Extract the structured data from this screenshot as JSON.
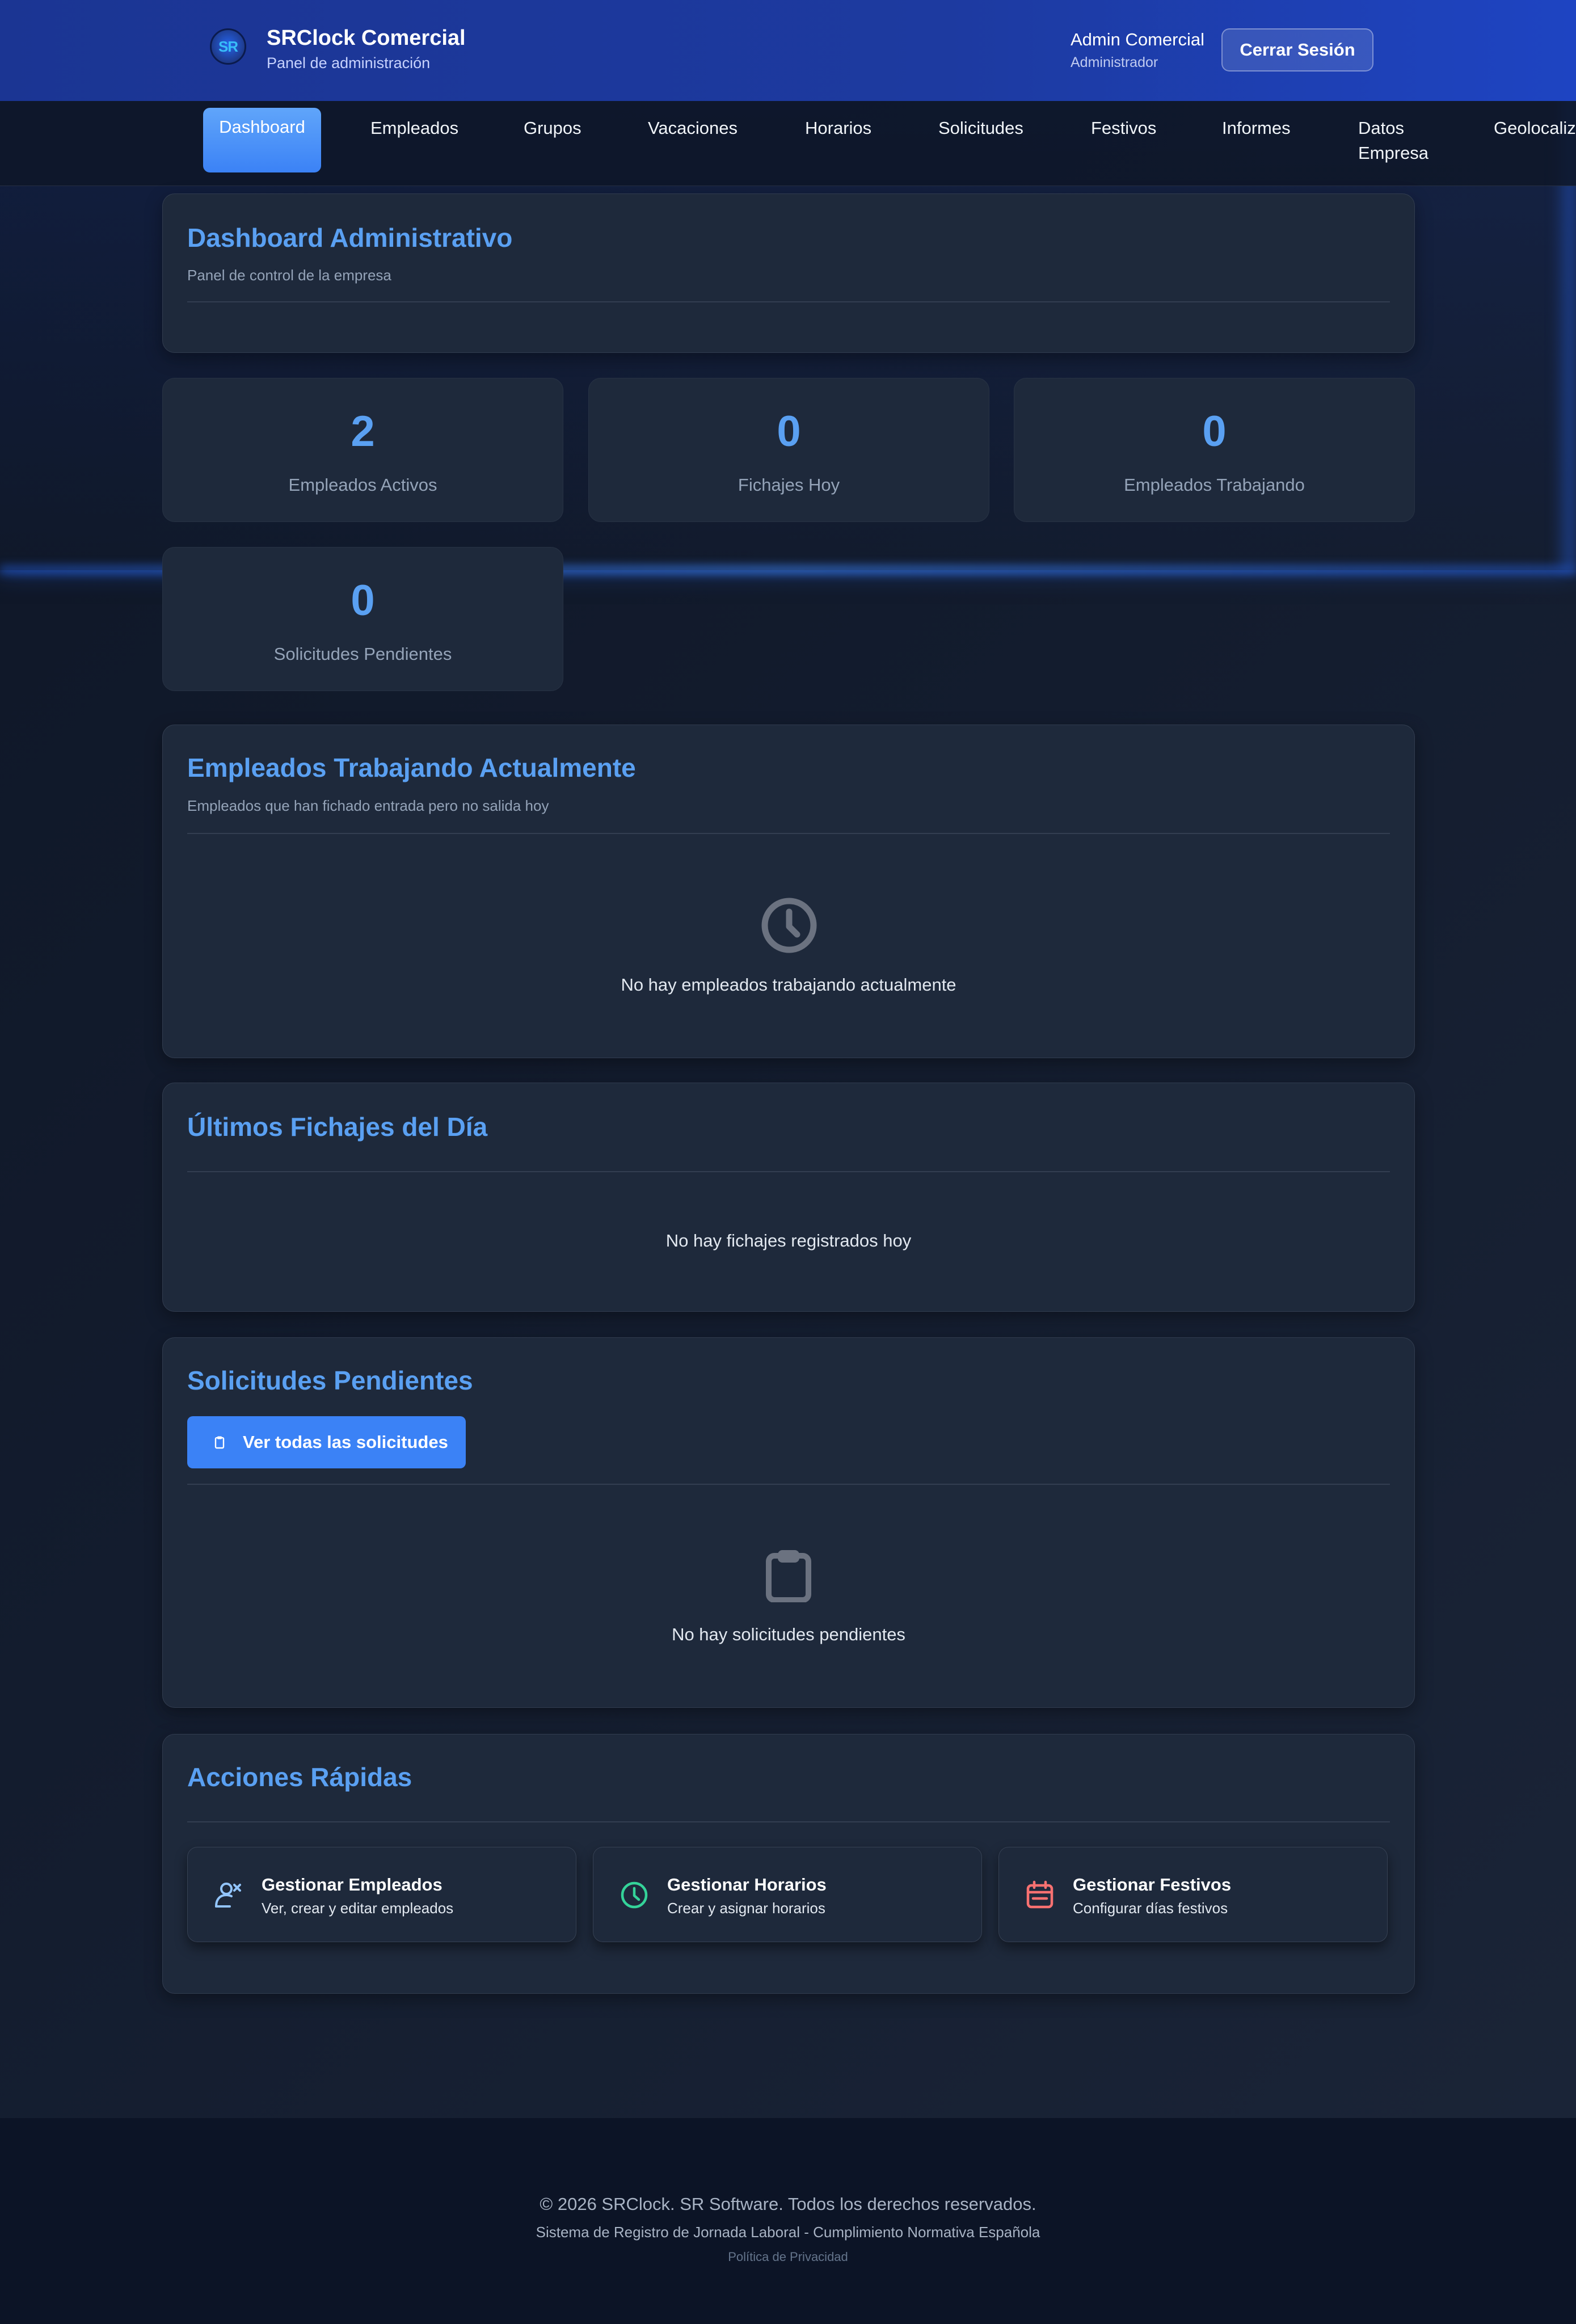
{
  "header": {
    "logo_text": "SR",
    "brand_title": "SRClock Comercial",
    "brand_subtitle": "Panel de administración",
    "user_name": "Admin Comercial",
    "user_role": "Administrador",
    "logout_label": "Cerrar Sesión"
  },
  "nav": {
    "items": [
      {
        "label": "Dashboard",
        "active": true
      },
      {
        "label": "Empleados"
      },
      {
        "label": "Grupos"
      },
      {
        "label": "Vacaciones"
      },
      {
        "label": "Horarios"
      },
      {
        "label": "Solicitudes"
      },
      {
        "label": "Festivos"
      },
      {
        "label": "Informes"
      },
      {
        "label": "Datos Empresa"
      },
      {
        "label": "Geolocaliz"
      }
    ]
  },
  "dashboard": {
    "title": "Dashboard Administrativo",
    "subtitle": "Panel de control de la empresa"
  },
  "stats": [
    {
      "value": "2",
      "label": "Empleados Activos"
    },
    {
      "value": "0",
      "label": "Fichajes Hoy"
    },
    {
      "value": "0",
      "label": "Empleados Trabajando"
    },
    {
      "value": "0",
      "label": "Solicitudes Pendientes"
    }
  ],
  "working_now": {
    "title": "Empleados Trabajando Actualmente",
    "subtitle": "Empleados que han fichado entrada pero no salida hoy",
    "empty_icon": "clock-icon",
    "empty_text": "No hay empleados trabajando actualmente"
  },
  "last_clockins": {
    "title": "Últimos Fichajes del Día",
    "empty_text": "No hay fichajes registrados hoy"
  },
  "pending_requests": {
    "title": "Solicitudes Pendientes",
    "button_label": "Ver todas las solicitudes",
    "button_icon": "clipboard-icon",
    "empty_icon": "clipboard-icon",
    "empty_text": "No hay solicitudes pendientes"
  },
  "quick_actions": {
    "title": "Acciones Rápidas",
    "items": [
      {
        "title": "Gestionar Empleados",
        "desc": "Ver, crear y editar empleados",
        "icon": "user-edit-icon",
        "color": "#93c5fd"
      },
      {
        "title": "Gestionar Horarios",
        "desc": "Crear y asignar horarios",
        "icon": "clock-icon",
        "color": "#34d399"
      },
      {
        "title": "Gestionar Festivos",
        "desc": "Configurar días festivos",
        "icon": "calendar-icon",
        "color": "#f87171"
      }
    ]
  },
  "footer": {
    "copyright": "© 2026 SRClock. SR Software. Todos los derechos reservados.",
    "tagline": "Sistema de Registro de Jornada Laboral - Cumplimiento Normativa Española",
    "privacy_link": "Política de Privacidad"
  },
  "colors": {
    "accent": "#5aa0f2",
    "primary_button": "#3b82f6",
    "header_bg": "#1d3aa0",
    "card_bg": "#1e293b",
    "page_bg": "#131c2e"
  }
}
